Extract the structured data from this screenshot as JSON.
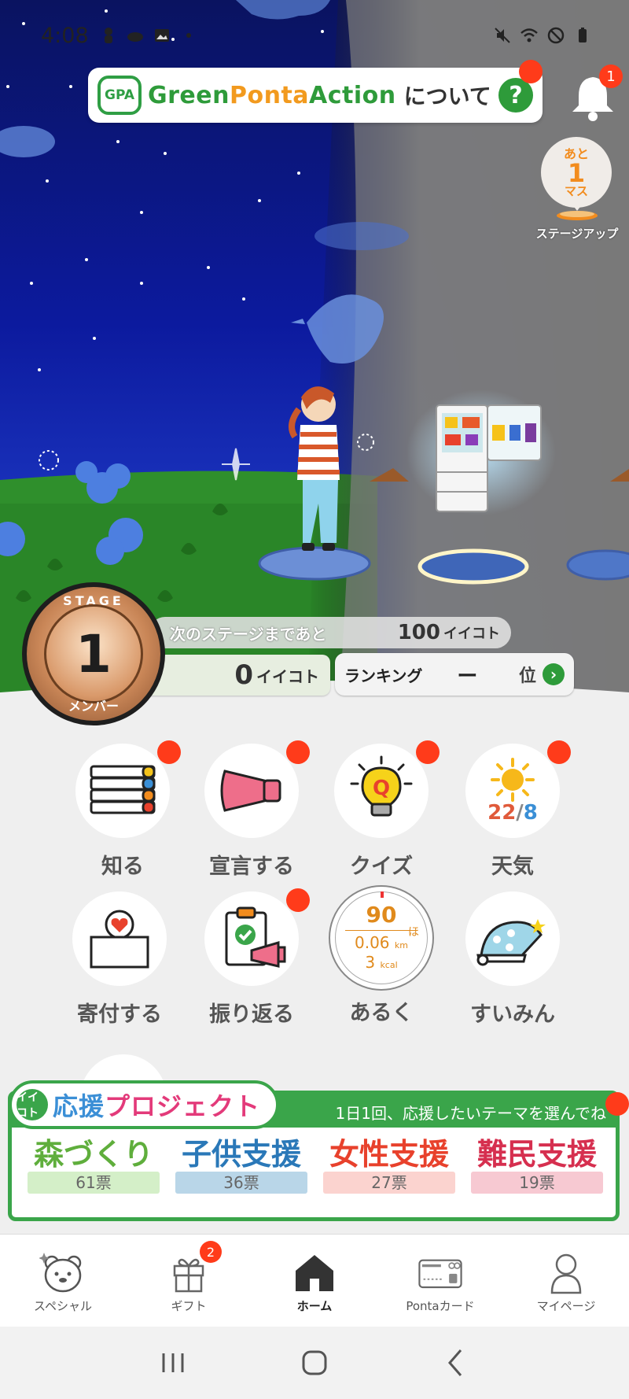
{
  "status_bar": {
    "time": "4:08",
    "icons_left": [
      "person-icon",
      "cloud-icon",
      "image-icon",
      "dot-icon"
    ],
    "icons_right": [
      "mute-icon",
      "wifi-icon",
      "blocked-icon",
      "battery-icon"
    ]
  },
  "header": {
    "logo_text": "GPA",
    "brand_green": "Green",
    "brand_ponta": "Ponta",
    "brand_action": "Action",
    "about_text": "について",
    "help_symbol": "?",
    "notification_count": "1"
  },
  "stage_up": {
    "prefix": "あと",
    "remaining": "1",
    "suffix": "マス",
    "label": "ステージアップ"
  },
  "stage": {
    "stage_word": "STAGE",
    "level": "1",
    "rank_name": "メンバー",
    "next_label": "次のステージまであと",
    "next_value": "100",
    "point_unit": "イイコト",
    "current_points": "0",
    "ranking_label": "ランキング",
    "ranking_value": "ー",
    "ranking_unit": "位",
    "ranking_go": "›"
  },
  "menu": {
    "items": [
      {
        "label": "知る"
      },
      {
        "label": "宣言する"
      },
      {
        "label": "クイズ"
      },
      {
        "label": "天気"
      },
      {
        "label": "寄付する"
      },
      {
        "label": "振り返る"
      },
      {
        "label": "あるく"
      },
      {
        "label": "すいみん"
      }
    ],
    "weather": {
      "high": "22",
      "sep": "/",
      "low": "8"
    },
    "quiz_letter": "Q",
    "walk": {
      "steps": "90",
      "steps_unit": "ほ",
      "km": "0.06",
      "km_unit": "km",
      "kcal": "3",
      "kcal_unit": "kcal"
    }
  },
  "support": {
    "logo_text": "イイコト",
    "title_a": "応援",
    "title_b": "プロジェクト",
    "subtitle": "1日1回、応援したいテーマを選んでね",
    "themes": [
      {
        "name": "森づくり",
        "votes": "61票",
        "color": "#5fae3c",
        "bg": "#d4efc8"
      },
      {
        "name": "子供支援",
        "votes": "36票",
        "color": "#2a78b8",
        "bg": "#b9d6e8"
      },
      {
        "name": "女性支援",
        "votes": "27票",
        "color": "#e8412c",
        "bg": "#fbd3cf"
      },
      {
        "name": "難民支援",
        "votes": "19票",
        "color": "#d62f4f",
        "bg": "#f7c9d2"
      }
    ]
  },
  "tabbar": {
    "tabs": [
      {
        "label": "スペシャル",
        "icon": "bear-icon"
      },
      {
        "label": "ギフト",
        "icon": "gift-icon",
        "badge": "2"
      },
      {
        "label": "ホーム",
        "icon": "home-icon"
      },
      {
        "label": "Pontaカード",
        "icon": "card-icon"
      },
      {
        "label": "マイページ",
        "icon": "person-icon"
      }
    ]
  },
  "colors": {
    "brand_green": "#2e9b3a",
    "notice_red": "#ff3b1a",
    "sky_blue": "#0d1fc4",
    "accent_orange": "#f28c1e"
  }
}
